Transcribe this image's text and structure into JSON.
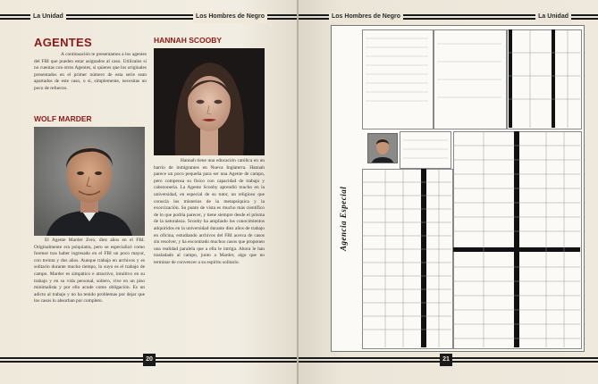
{
  "header": {
    "left_title": "La Unidad",
    "center_left": "Los Hombres de Negro",
    "center_right": "Los Hombres de Negro",
    "right_title": "La Unidad"
  },
  "left_page": {
    "heading": "AGENTES",
    "intro": "A continuación te presentamos a los agentes del FBI que pueden estar asignados al caso. Utilízalos si no cuentas con otros Agentes, si quieres que los originales presentados en el primer número de esta serie sean apartados de este caso, o si, simplemente, necesitas un poco de refuerzo.",
    "wolf_name": "WOLF MARDER",
    "wolf_text": "El Agente Marder Zero, diez años en el FBI. Originalmente era psiquiatra, pero se especializó como forense tras haber ingresado en el FBI un poco mayor, con treinta y dos años. Aunque trabaja en archivos y es solitario durante mucho tiempo, lo suyo es el trabajo de campo. Marder es simpático e atractivo, intuitivo en su trabajo y en su vida personal, soltero, vive en un piso minimalista y por ello acude como obligación. Es un adicto al trabajo y no ha tenido problemas por dejar que los casos lo absorban por completo.",
    "hannah_name": "HANNAH SCOOBY",
    "hannah_text": "Hannah tiene una educación católica en un barrio de inmigrantes en Nueva Inglaterra. Hannah parece un poco pequeña para ser una Agente de campo, pero compensa su físico con capacidad de trabajo y cabezonería. La Agente Scooby aprendió mucho en la universidad, en especial de su tutor, un religioso que conocía los misterios de la metapsíquica y la exorcización. Su punto de vista es mucho más científico de lo que podría parecer, y tiene siempre desde el prisma de la naturaleza. Scooby ha ampliado los conocimientos adquiridos en la universidad durante diez años de trabajo en oficina, estudiando archivos del FBI acerca de casos sin resolver, y ha encontrado muchos casos que proponen una realidad paralela que a ella le intriga. Ahora le han trasladado al campo, junto a Marder, algo que no terminar de convencer a su espíritu solitario.",
    "page_number": "20"
  },
  "right_page": {
    "sheet_title": "Agencia Especial",
    "page_number": "21"
  }
}
